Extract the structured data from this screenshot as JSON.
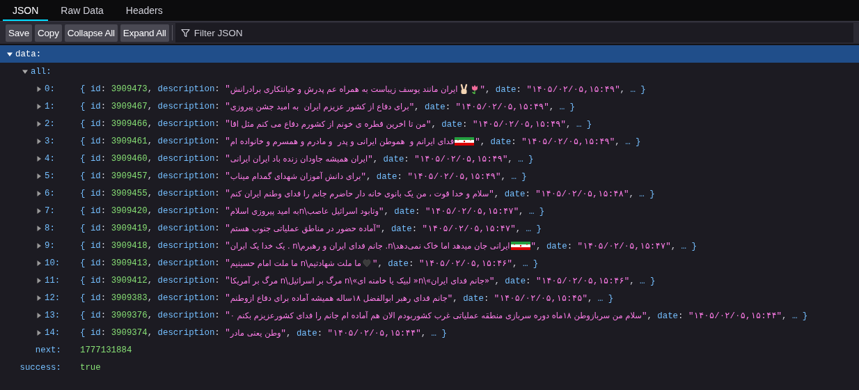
{
  "tabs": {
    "json": {
      "label": "JSON",
      "selected": true
    },
    "raw_data": {
      "label": "Raw Data",
      "selected": false
    },
    "headers": {
      "label": "Headers",
      "selected": false
    }
  },
  "toolbar": {
    "save": "Save",
    "copy": "Copy",
    "collapse_all": "Collapse All",
    "expand_all": "Expand All",
    "filter": {
      "placeholder": "Filter JSON"
    }
  },
  "tree": {
    "key": "data:",
    "expanded": true,
    "selected": true,
    "children": [
      {
        "key": "all:",
        "expanded": true,
        "selected": false,
        "items": [
          {
            "key": "0:",
            "expanded": false,
            "head": "{ id: 3909473, description: \"",
            "description": "ایران مانند یوسف زیباست به همراه عم پدرش و خیانتکاری برادرانش",
            "emojis": [
              {
                "kind": "tulip"
              },
              {
                "kind": "victory-hand"
              }
            ],
            "tail": "\", date: \"۱۴۰۵/۰۲/۰۵,۱۵:۴۹\", … }"
          },
          {
            "key": "1:",
            "expanded": false,
            "head": "{ id: 3909467, description: \"",
            "description": "برای دفاع از کشور عزیزم ایران  به امید جشن پیروزی",
            "tail": "\", date: \"۱۴۰۵/۰۲/۰۵,۱۵:۴۹\", … }"
          },
          {
            "key": "2:",
            "expanded": false,
            "head": "{ id: 3909466, description: \"",
            "description": "من تا اخرین قطره ی خونم از کشورم دفاع می کنم مثل اقا",
            "tail": "\", date: \"۱۴۰۵/۰۲/۰۵,۱۵:۴۹\", … }"
          },
          {
            "key": "3:",
            "expanded": false,
            "head": "{ id: 3909461, description: \"",
            "description": "فدای ایرانم و  هموطن ایرانی و پدر  و مادرم و همسرم و خانواده ام",
            "emojis": [
              {
                "kind": "flag"
              }
            ],
            "tail": "\", date: \"۱۴۰۵/۰۲/۰۵,۱۵:۴۹\", … }"
          },
          {
            "key": "4:",
            "expanded": false,
            "head": "{ id: 3909460, description: \"",
            "description": "ایران همیشه جاودان زنده باد ایران ایرانی",
            "tail": "\", date: \"۱۴۰۵/۰۲/۰۵,۱۵:۴۹\", … }"
          },
          {
            "key": "5:",
            "expanded": false,
            "head": "{ id: 3909457, description: \"",
            "description": "برای دانش آموزان شهدای گمدام میناب",
            "tail": "\", date: \"۱۴۰۵/۰۲/۰۵,۱۵:۴۹\", … }"
          },
          {
            "key": "6:",
            "expanded": false,
            "head": "{ id: 3909455, description: \"",
            "description": "سلام و خدا قوت ، من یک بانوی خانه دار حاضرم جانم را فدای وطنم ایران کنم",
            "tail": "\", date: \"۱۴۰۵/۰۲/۰۵,۱۵:۴۸\", … }"
          },
          {
            "key": "7:",
            "expanded": false,
            "head": "{ id: 3909420, description: \"",
            "description": "وتابود اسرائیل عاصب\\nبه امید پیروزی اسلام",
            "tail": "\", date: \"۱۴۰۵/۰۲/۰۵,۱۵:۴۷\", … }"
          },
          {
            "key": "8:",
            "expanded": false,
            "head": "{ id: 3909419, description: \"",
            "description": "آماده حضور در مناطق عملیاتی جنوب هستم",
            "tail": "\", date: \"۱۴۰۵/۰۲/۰۵,۱۵:۴۷\", … }"
          },
          {
            "key": "9:",
            "expanded": false,
            "head": "{ id: 3909418, description: \"",
            "description": "ایرانی جان میدهد اما خاک نمی‌دهد\\n. جانم فدای ایران و رهبرم\\n . یک خدا یک ایران",
            "emojis": [
              {
                "kind": "flag"
              }
            ],
            "tail": "\", date: \"۱۴۰۵/۰۲/۰۵,۱۵:۴۷\", … }"
          },
          {
            "key": "10:",
            "expanded": false,
            "head": "{ id: 3909413, description: \"",
            "description": "ما ملت شهادتیم\\n ما ملت امام حسینیم",
            "emojis": [
              {
                "kind": "heart"
              }
            ],
            "tail": "\", date: \"۱۴۰۵/۰۲/۰۵,۱۵:۴۶\", … }"
          },
          {
            "key": "11:",
            "expanded": false,
            "head": "{ id: 3909412, description: \"",
            "description": "«جانم فدای ایران»\\n« لبیک یا خامنه ای»\\n مرگ بر اسرائیل\\n مرگ بر آمریکا",
            "tail": "\", date: \"۱۴۰۵/۰۲/۰۵,۱۵:۴۶\", … }"
          },
          {
            "key": "12:",
            "expanded": false,
            "head": "{ id: 3909383, description: \"",
            "description": "جانم فدای رهبر ابوالفضل ۱۸ساله همیشه آماده برای دفاع ازوطنم",
            "tail": "\", date: \"۱۴۰۵/۰۲/۰۵,۱۵:۴۵\", … }"
          },
          {
            "key": "13:",
            "expanded": false,
            "head": "{ id: 3909376, description: \"",
            "description": "سلام من سربازوطن ۱۸ماه دوره سربازی منطقه عملیاتی غرب کشوربودم الان هم آماده ام جانم را فدای کشورعزیزم بکنم ۰",
            "tail": "\", date: \"۱۴۰۵/۰۲/۰۵,۱۵:۴۴\", … }"
          },
          {
            "key": "14:",
            "expanded": false,
            "head": "{ id: 3909374, description: \"",
            "description": "وطن یعنی مادر",
            "tail": "\", date: \"۱۴۰۵/۰۲/۰۵,۱۵:۴۴\", … }"
          }
        ]
      },
      {
        "key": "next:",
        "value": "1777131884"
      },
      {
        "key": "success:",
        "value": "true"
      }
    ]
  }
}
